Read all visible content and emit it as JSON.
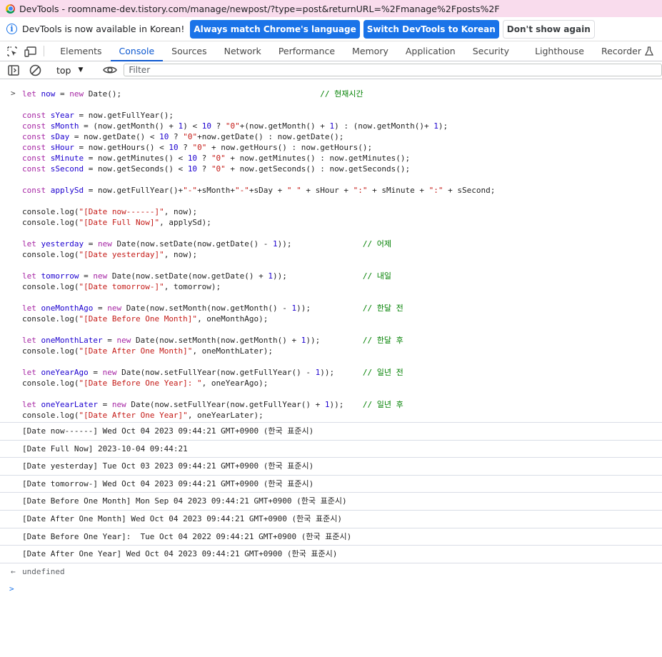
{
  "window": {
    "title": "DevTools - roomname-dev.tistory.com/manage/newpost/?type=post&returnURL=%2Fmanage%2Fposts%2F"
  },
  "infobar": {
    "message": "DevTools is now available in Korean!",
    "btn_match": "Always match Chrome's language",
    "btn_switch": "Switch DevTools to Korean",
    "btn_dismiss": "Don't show again"
  },
  "tabs": [
    "Elements",
    "Console",
    "Sources",
    "Network",
    "Performance",
    "Memory",
    "Application",
    "Security",
    "Lighthouse",
    "Recorder"
  ],
  "active_tab": "Console",
  "console_toolbar": {
    "context": "top",
    "filter_placeholder": "Filter"
  },
  "code_lines": [
    "let now = new Date();                                          // 현재시간",
    "",
    "const sYear = now.getFullYear();",
    "const sMonth = (now.getMonth() + 1) < 10 ? \"0\"+(now.getMonth() + 1) : (now.getMonth()+ 1);",
    "const sDay = now.getDate() < 10 ? \"0\"+now.getDate() : now.getDate();",
    "const sHour = now.getHours() < 10 ? \"0\" + now.getHours() : now.getHours();",
    "const sMinute = now.getMinutes() < 10 ? \"0\" + now.getMinutes() : now.getMinutes();",
    "const sSecond = now.getSeconds() < 10 ? \"0\" + now.getSeconds() : now.getSeconds();",
    "",
    "const applySd = now.getFullYear()+\"-\"+sMonth+\"-\"+sDay + \" \" + sHour + \":\" + sMinute + \":\" + sSecond;",
    "",
    "console.log(\"[Date now------]\", now);",
    "console.log(\"[Date Full Now]\", applySd);",
    "",
    "let yesterday = new Date(now.setDate(now.getDate() - 1));               // 어제",
    "console.log(\"[Date yesterday]\", now);",
    "",
    "let tomorrow = new Date(now.setDate(now.getDate() + 1));                // 내일",
    "console.log(\"[Date tomorrow-]\", tomorrow);",
    "",
    "let oneMonthAgo = new Date(now.setMonth(now.getMonth() - 1));           // 한달 전",
    "console.log(\"[Date Before One Month]\", oneMonthAgo);",
    "",
    "let oneMonthLater = new Date(now.setMonth(now.getMonth() + 1));         // 한달 후",
    "console.log(\"[Date After One Month]\", oneMonthLater);",
    "",
    "let oneYearAgo = new Date(now.setFullYear(now.getFullYear() - 1));      // 일년 전",
    "console.log(\"[Date Before One Year]: \", oneYearAgo);",
    "",
    "let oneYearLater = new Date(now.setFullYear(now.getFullYear() + 1));    // 일년 후",
    "console.log(\"[Date After One Year]\", oneYearLater);"
  ],
  "log_output": [
    "[Date now------] Wed Oct 04 2023 09:44:21 GMT+0900 (한국 표준시)",
    "[Date Full Now] 2023-10-04 09:44:21",
    "[Date yesterday] Tue Oct 03 2023 09:44:21 GMT+0900 (한국 표준시)",
    "[Date tomorrow-] Wed Oct 04 2023 09:44:21 GMT+0900 (한국 표준시)",
    "[Date Before One Month] Mon Sep 04 2023 09:44:21 GMT+0900 (한국 표준시)",
    "[Date After One Month] Wed Oct 04 2023 09:44:21 GMT+0900 (한국 표준시)",
    "[Date Before One Year]:  Tue Oct 04 2022 09:44:21 GMT+0900 (한국 표준시)",
    "[Date After One Year] Wed Oct 04 2023 09:44:21 GMT+0900 (한국 표준시)"
  ],
  "result": "undefined",
  "icons": {
    "inspect": "inspect-element-icon",
    "device": "device-toolbar-icon",
    "sidebar": "sidebar-toggle-icon",
    "clear": "clear-console-icon",
    "eye": "live-expression-icon",
    "recorder": "flask-icon"
  }
}
